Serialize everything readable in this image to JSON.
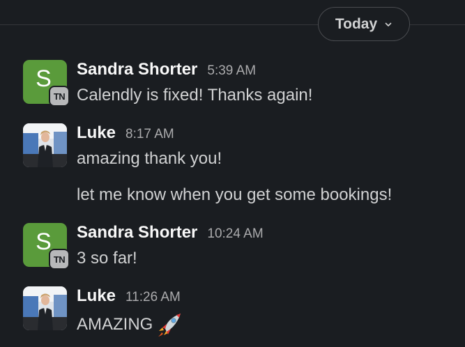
{
  "date_divider": {
    "label": "Today"
  },
  "messages": [
    {
      "sender": "Sandra Shorter",
      "time": "5:39 AM",
      "avatar_letter": "S",
      "badge": "TN",
      "lines": [
        "Calendly is fixed! Thanks again!"
      ]
    },
    {
      "sender": "Luke",
      "time": "8:17 AM",
      "lines": [
        "amazing thank you!",
        "let me know when you get some bookings!"
      ]
    },
    {
      "sender": "Sandra Shorter",
      "time": "10:24 AM",
      "avatar_letter": "S",
      "badge": "TN",
      "lines": [
        "3 so far!"
      ]
    },
    {
      "sender": "Luke",
      "time": "11:26 AM",
      "lines": [
        "AMAZING"
      ],
      "emoji": "rocket-icon"
    }
  ],
  "colors": {
    "background": "#1a1d21",
    "avatar_green": "#5a9b3b",
    "text": "#d1d2d3",
    "muted": "#ababad"
  }
}
